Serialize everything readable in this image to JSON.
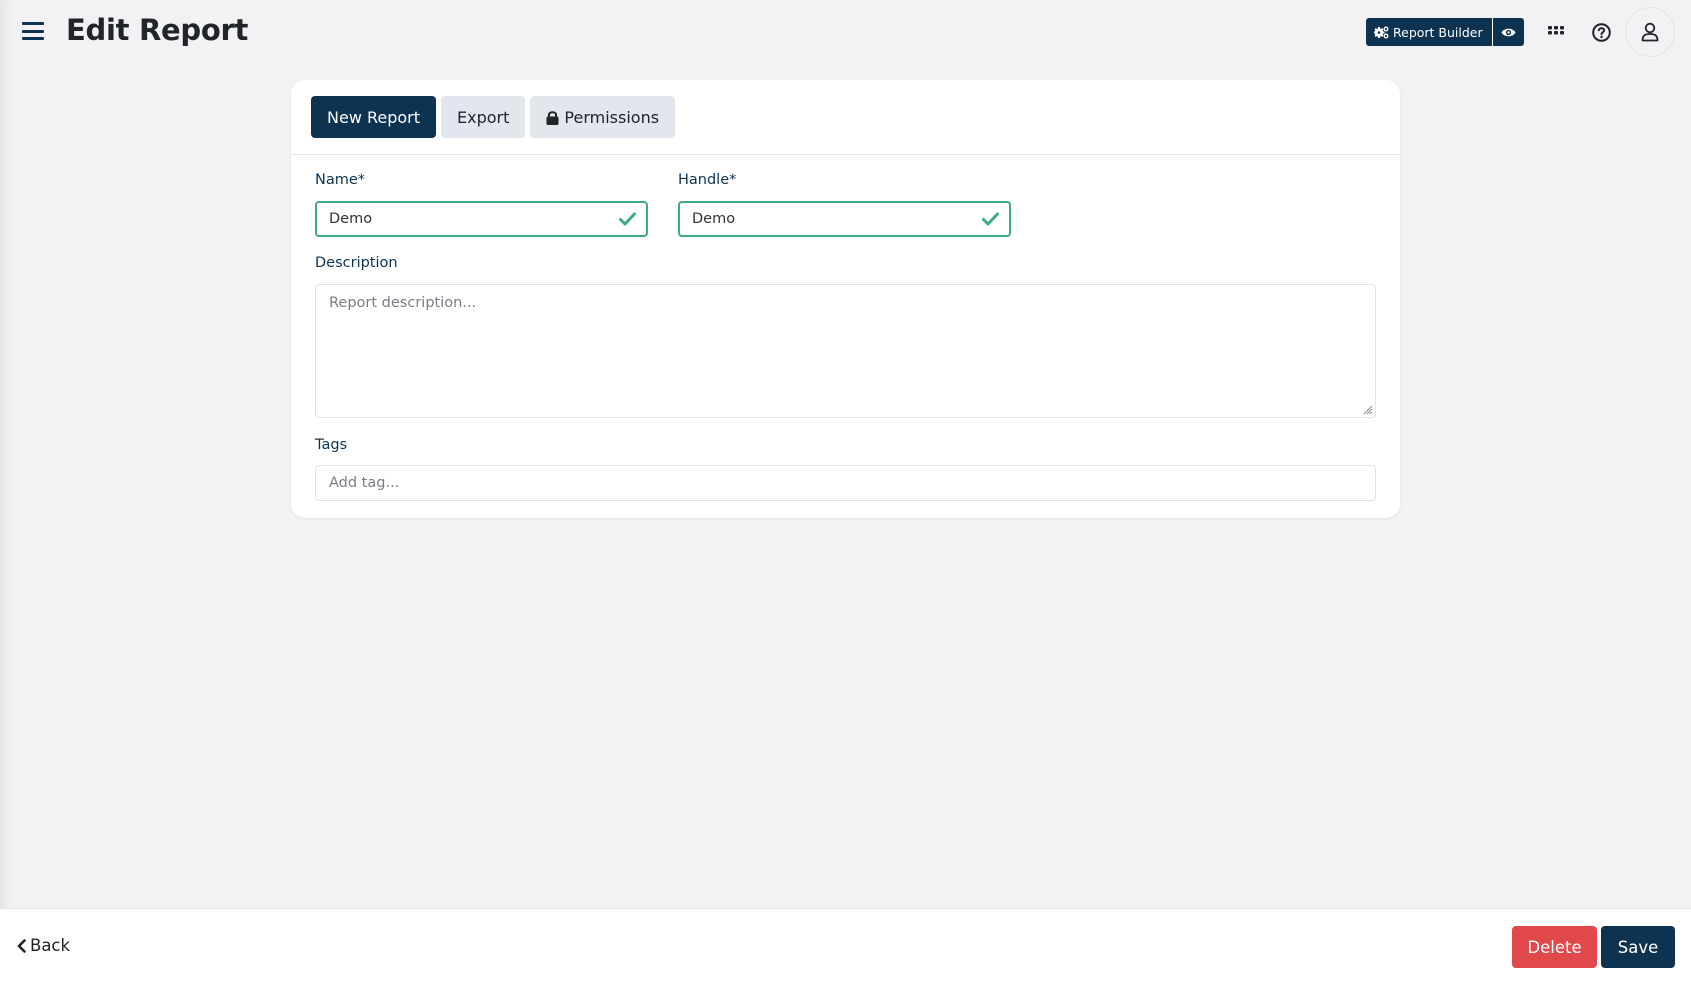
{
  "header": {
    "title": "Edit Report",
    "menu_icon": "hamburger-icon",
    "report_builder_label": "Report Builder",
    "report_builder_icon": "gears-icon",
    "preview_icon": "eye-icon",
    "apps_icon": "grid-icon",
    "help_icon": "question-circle-icon",
    "user_icon": "user-icon"
  },
  "tabs": [
    {
      "label": "New Report",
      "active": true
    },
    {
      "label": "Export",
      "active": false
    },
    {
      "label": "Permissions",
      "active": false,
      "icon": "lock-icon"
    }
  ],
  "form": {
    "name": {
      "label": "Name*",
      "value": "Demo",
      "valid": true
    },
    "handle": {
      "label": "Handle*",
      "value": "Demo",
      "valid": true
    },
    "description": {
      "label": "Description",
      "value": "",
      "placeholder": "Report description..."
    },
    "tags": {
      "label": "Tags",
      "value": "",
      "placeholder": "Add tag..."
    }
  },
  "footer": {
    "back_label": "Back",
    "delete_label": "Delete",
    "save_label": "Save"
  },
  "colors": {
    "primary": "#0d3350",
    "danger": "#e0494b",
    "valid": "#3fa88a",
    "background": "#f2f2f4"
  }
}
